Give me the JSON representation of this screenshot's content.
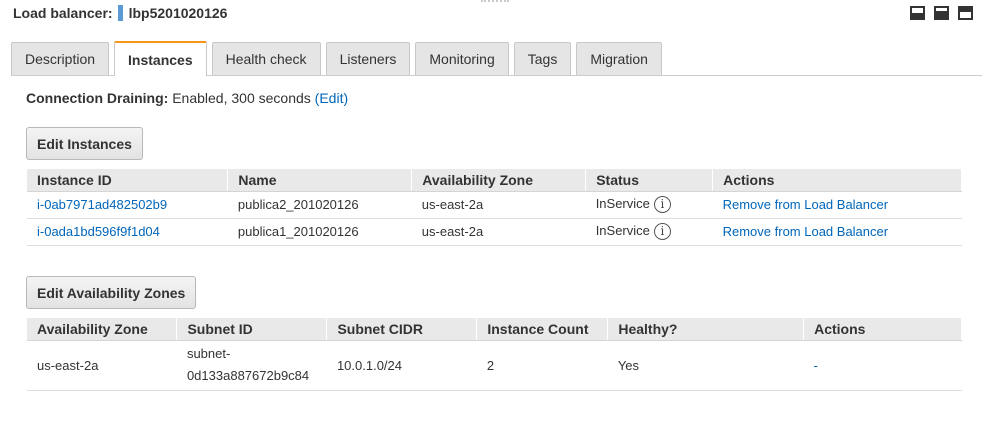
{
  "header": {
    "label": "Load balancer:",
    "name": "lbp5201020126"
  },
  "window_controls": [
    "bottom-pane-icon",
    "half-pane-icon",
    "full-pane-icon"
  ],
  "tabs": [
    {
      "label": "Description",
      "active": false
    },
    {
      "label": "Instances",
      "active": true
    },
    {
      "label": "Health check",
      "active": false
    },
    {
      "label": "Listeners",
      "active": false
    },
    {
      "label": "Monitoring",
      "active": false
    },
    {
      "label": "Tags",
      "active": false
    },
    {
      "label": "Migration",
      "active": false
    }
  ],
  "connection_draining": {
    "label": "Connection Draining:",
    "value": "Enabled, 300 seconds",
    "edit_link": "(Edit)"
  },
  "instances": {
    "edit_button": "Edit Instances",
    "columns": [
      "Instance ID",
      "Name",
      "Availability Zone",
      "Status",
      "Actions"
    ],
    "rows": [
      {
        "id": "i-0ab7971ad482502b9",
        "name": "publica2_201020126",
        "zone": "us-east-2a",
        "status": "InService",
        "action": "Remove from Load Balancer"
      },
      {
        "id": "i-0ada1bd596f9f1d04",
        "name": "publica1_201020126",
        "zone": "us-east-2a",
        "status": "InService",
        "action": "Remove from Load Balancer"
      }
    ]
  },
  "zones": {
    "edit_button": "Edit Availability Zones",
    "columns": [
      "Availability Zone",
      "Subnet ID",
      "Subnet CIDR",
      "Instance Count",
      "Healthy?",
      "Actions"
    ],
    "rows": [
      {
        "zone": "us-east-2a",
        "subnet_line1": "subnet-",
        "subnet_line2": "0d133a887672b9c84",
        "cidr": "10.0.1.0/24",
        "count": "2",
        "healthy": "Yes",
        "action": "-"
      }
    ]
  },
  "colors": {
    "link": "#0066bb",
    "active_tab_accent": "#f7981d",
    "header_marker": "#5b9bd5"
  },
  "icons": {
    "status_info": "i"
  }
}
